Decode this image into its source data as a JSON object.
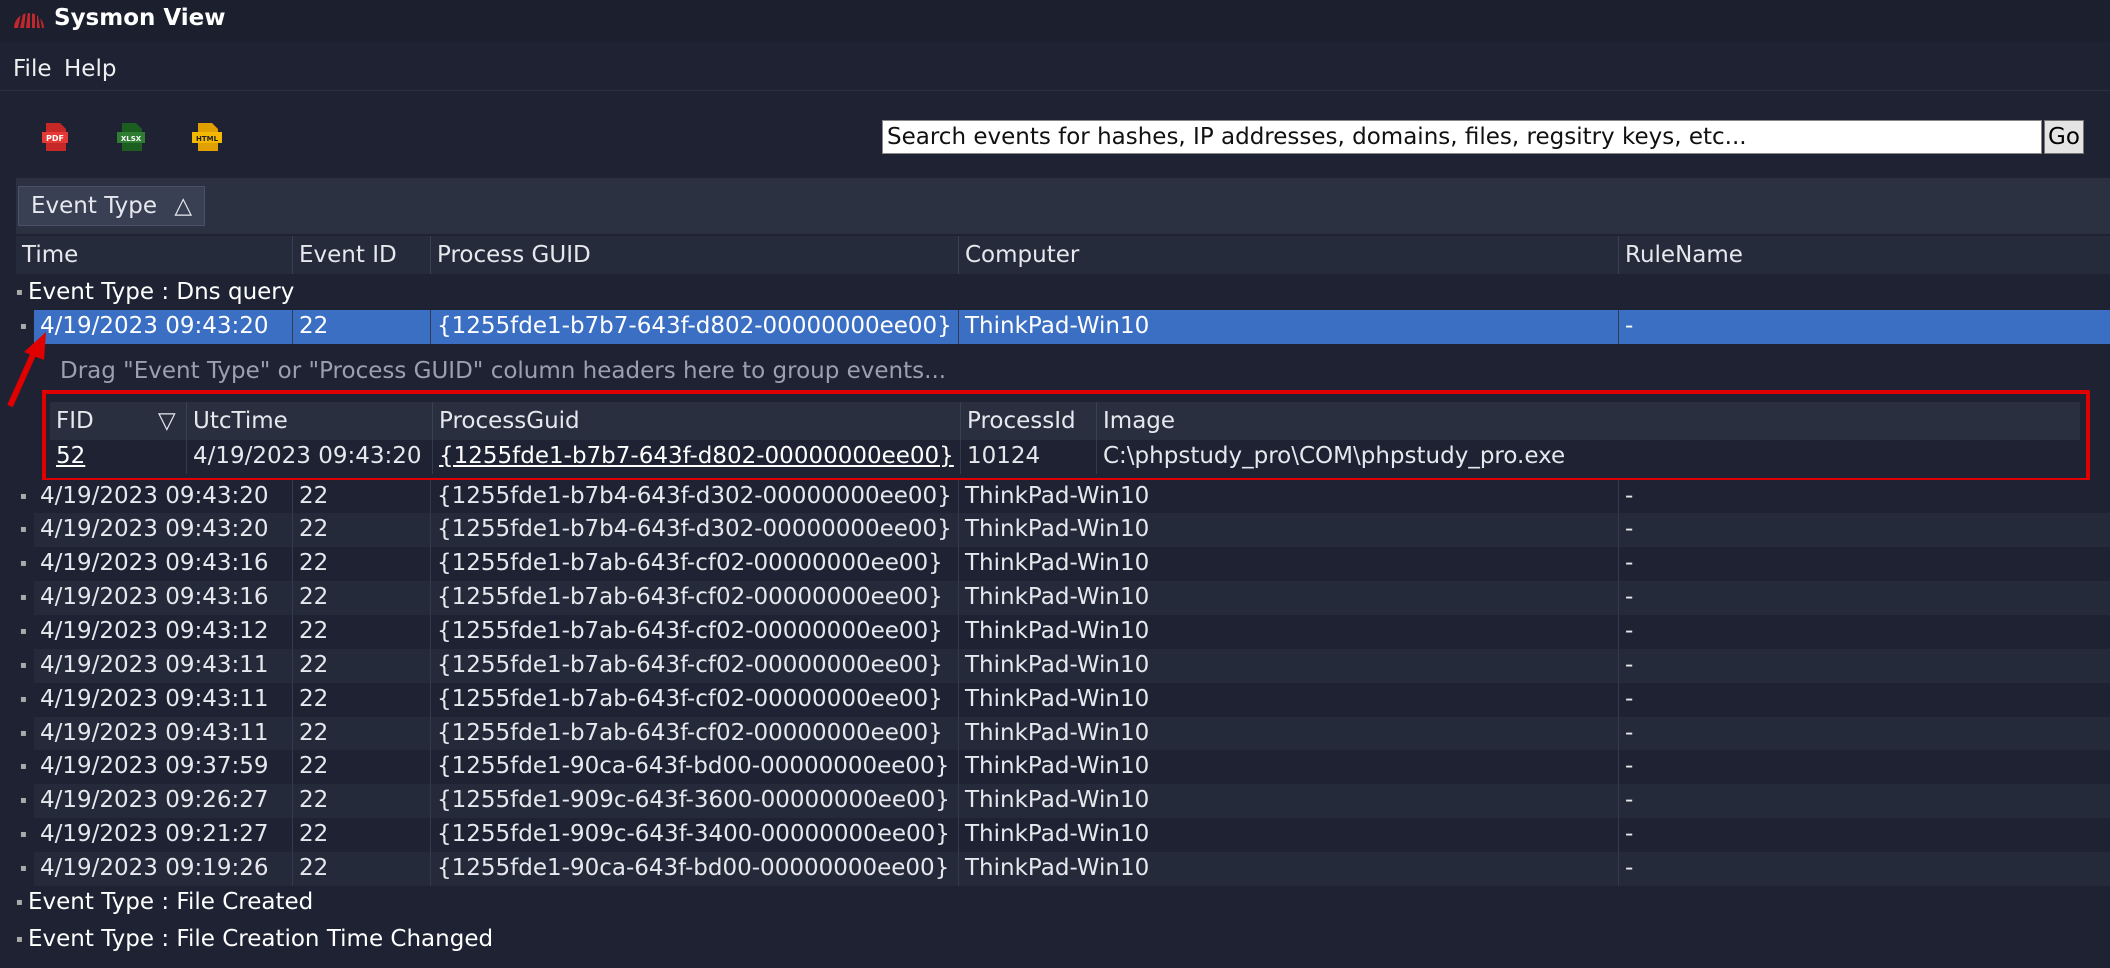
{
  "app": {
    "title": "Sysmon View",
    "icon": "sysmon-logo-icon"
  },
  "menu": [
    {
      "label": "File"
    },
    {
      "label": "Help"
    }
  ],
  "toolbar": {
    "buttons": [
      {
        "icon": "pdf-export-icon",
        "text": "PDF"
      },
      {
        "icon": "xlsx-export-icon",
        "text": "XLSX"
      },
      {
        "icon": "html-export-icon",
        "text": "HTML"
      }
    ],
    "search_value": "Search events for hashes, IP addresses, domains, files, regsitry keys, etc...",
    "go_label": "Go"
  },
  "group_panel": {
    "chip_label": "Event Type",
    "chip_sort_glyph": "△"
  },
  "columns": [
    "Time",
    "Event ID",
    "Process GUID",
    "Computer",
    "RuleName"
  ],
  "groups": [
    {
      "label": "Event Type : Dns query"
    },
    {
      "label": "Event Type : File Created"
    },
    {
      "label": "Event Type : File Creation Time Changed"
    }
  ],
  "selected_row": {
    "time": "4/19/2023 09:43:20",
    "event_id": "22",
    "process_guid": "{1255fde1-b7b7-643f-d802-00000000ee00}",
    "computer": "ThinkPad-Win10",
    "rule": "-"
  },
  "detail": {
    "hint": "Drag \"Event Type\" or \"Process GUID\" column headers here to group events...",
    "columns": [
      "FID",
      "UtcTime",
      "ProcessGuid",
      "ProcessId",
      "Image"
    ],
    "sort_glyph": "▽",
    "row": {
      "fid": "52",
      "utc_time": "4/19/2023 09:43:20",
      "process_guid": "{1255fde1-b7b7-643f-d802-00000000ee00}",
      "process_id": "10124",
      "image": "C:\\phpstudy_pro\\COM\\phpstudy_pro.exe"
    }
  },
  "rows": [
    {
      "time": "4/19/2023 09:43:20",
      "event_id": "22",
      "process_guid": "{1255fde1-b7b4-643f-d302-00000000ee00}",
      "computer": "ThinkPad-Win10",
      "rule": "-"
    },
    {
      "time": "4/19/2023 09:43:20",
      "event_id": "22",
      "process_guid": "{1255fde1-b7b4-643f-d302-00000000ee00}",
      "computer": "ThinkPad-Win10",
      "rule": "-"
    },
    {
      "time": "4/19/2023 09:43:16",
      "event_id": "22",
      "process_guid": "{1255fde1-b7ab-643f-cf02-00000000ee00}",
      "computer": "ThinkPad-Win10",
      "rule": "-"
    },
    {
      "time": "4/19/2023 09:43:16",
      "event_id": "22",
      "process_guid": "{1255fde1-b7ab-643f-cf02-00000000ee00}",
      "computer": "ThinkPad-Win10",
      "rule": "-"
    },
    {
      "time": "4/19/2023 09:43:12",
      "event_id": "22",
      "process_guid": "{1255fde1-b7ab-643f-cf02-00000000ee00}",
      "computer": "ThinkPad-Win10",
      "rule": "-"
    },
    {
      "time": "4/19/2023 09:43:11",
      "event_id": "22",
      "process_guid": "{1255fde1-b7ab-643f-cf02-00000000ee00}",
      "computer": "ThinkPad-Win10",
      "rule": "-"
    },
    {
      "time": "4/19/2023 09:43:11",
      "event_id": "22",
      "process_guid": "{1255fde1-b7ab-643f-cf02-00000000ee00}",
      "computer": "ThinkPad-Win10",
      "rule": "-"
    },
    {
      "time": "4/19/2023 09:43:11",
      "event_id": "22",
      "process_guid": "{1255fde1-b7ab-643f-cf02-00000000ee00}",
      "computer": "ThinkPad-Win10",
      "rule": "-"
    },
    {
      "time": "4/19/2023 09:37:59",
      "event_id": "22",
      "process_guid": "{1255fde1-90ca-643f-bd00-00000000ee00}",
      "computer": "ThinkPad-Win10",
      "rule": "-"
    },
    {
      "time": "4/19/2023 09:26:27",
      "event_id": "22",
      "process_guid": "{1255fde1-909c-643f-3600-00000000ee00}",
      "computer": "ThinkPad-Win10",
      "rule": "-"
    },
    {
      "time": "4/19/2023 09:21:27",
      "event_id": "22",
      "process_guid": "{1255fde1-909c-643f-3400-00000000ee00}",
      "computer": "ThinkPad-Win10",
      "rule": "-"
    },
    {
      "time": "4/19/2023 09:19:26",
      "event_id": "22",
      "process_guid": "{1255fde1-90ca-643f-bd00-00000000ee00}",
      "computer": "ThinkPad-Win10",
      "rule": "-"
    }
  ]
}
